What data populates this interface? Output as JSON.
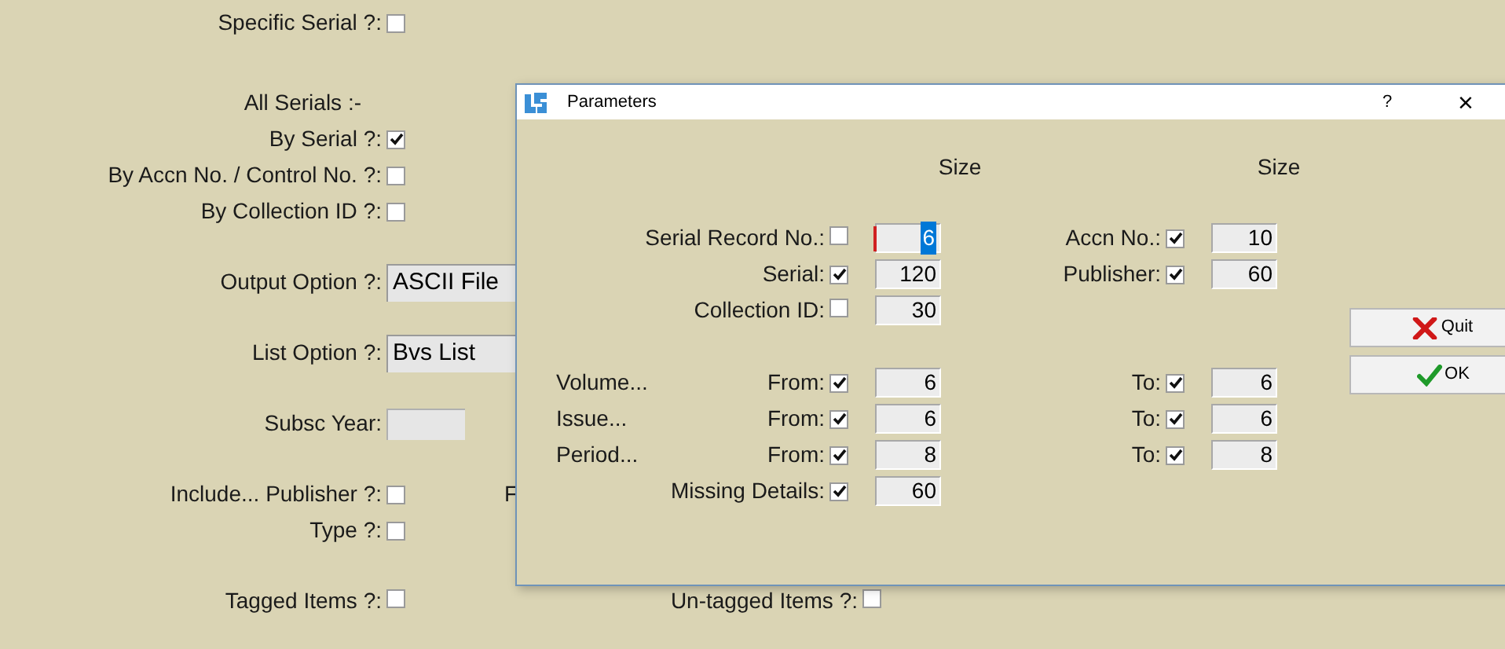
{
  "form": {
    "groups": [
      [
        {
          "kind": "checkbox",
          "label": "Specific Serial ?:",
          "checked": false
        }
      ],
      [
        {
          "kind": "heading",
          "label": "All Serials :-"
        },
        {
          "kind": "checkbox",
          "label": "By Serial ?:",
          "checked": true
        },
        {
          "kind": "checkbox",
          "label": "By Accn No. / Control No. ?:",
          "checked": false
        },
        {
          "kind": "checkbox",
          "label": "By Collection ID ?:",
          "checked": false
        }
      ],
      [
        {
          "kind": "select",
          "label": "Output Option ?:",
          "value": "ASCII File"
        }
      ],
      [
        {
          "kind": "select",
          "label": "List Option ?:",
          "value": "Bvs List"
        }
      ],
      [
        {
          "kind": "field",
          "label": "Subsc Year:"
        }
      ],
      [
        {
          "kind": "checkbox",
          "label": "Include... Publisher ?:",
          "checked": false,
          "partial_label": "F"
        },
        {
          "kind": "checkbox",
          "label": "Type ?:",
          "checked": false
        }
      ]
    ],
    "bottom_row": [
      {
        "label": "Tagged Items ?:",
        "checked": false
      },
      {
        "label": "Un-tagged Items ?:",
        "checked": false
      }
    ]
  },
  "dialog": {
    "title": "Parameters",
    "help": "?",
    "close": "×",
    "size_headers": [
      "Size",
      "Size"
    ],
    "top_rows": [
      {
        "left": {
          "label": "Serial Record No.:",
          "checked": false,
          "size": "6",
          "focused": true
        },
        "right": {
          "label": "Accn No.:",
          "checked": true,
          "size": "10"
        }
      },
      {
        "left": {
          "label": "Serial:",
          "checked": true,
          "size": "120",
          "focused": false
        },
        "right": {
          "label": "Publisher:",
          "checked": true,
          "size": "60"
        }
      },
      {
        "left": {
          "label": "Collection ID:",
          "checked": false,
          "size": "30",
          "focused": false
        }
      }
    ],
    "range_rows": [
      {
        "left": {
          "prefix": "Volume...",
          "label": "From:",
          "checked": true,
          "size": "6",
          "focused": false
        },
        "right": {
          "label": "To:",
          "checked": true,
          "size": "6"
        }
      },
      {
        "left": {
          "prefix": "Issue...",
          "label": "From:",
          "checked": true,
          "size": "6",
          "focused": false
        },
        "right": {
          "label": "To:",
          "checked": true,
          "size": "6"
        }
      },
      {
        "left": {
          "prefix": "Period...",
          "label": "From:",
          "checked": true,
          "size": "8",
          "focused": false
        },
        "right": {
          "label": "To:",
          "checked": true,
          "size": "8"
        }
      },
      {
        "left": {
          "label": "Missing Details:",
          "checked": true,
          "size": "60",
          "focused": false
        }
      }
    ],
    "buttons": [
      {
        "kind": "quit",
        "label": "Quit"
      },
      {
        "kind": "ok",
        "label": "OK"
      }
    ]
  }
}
